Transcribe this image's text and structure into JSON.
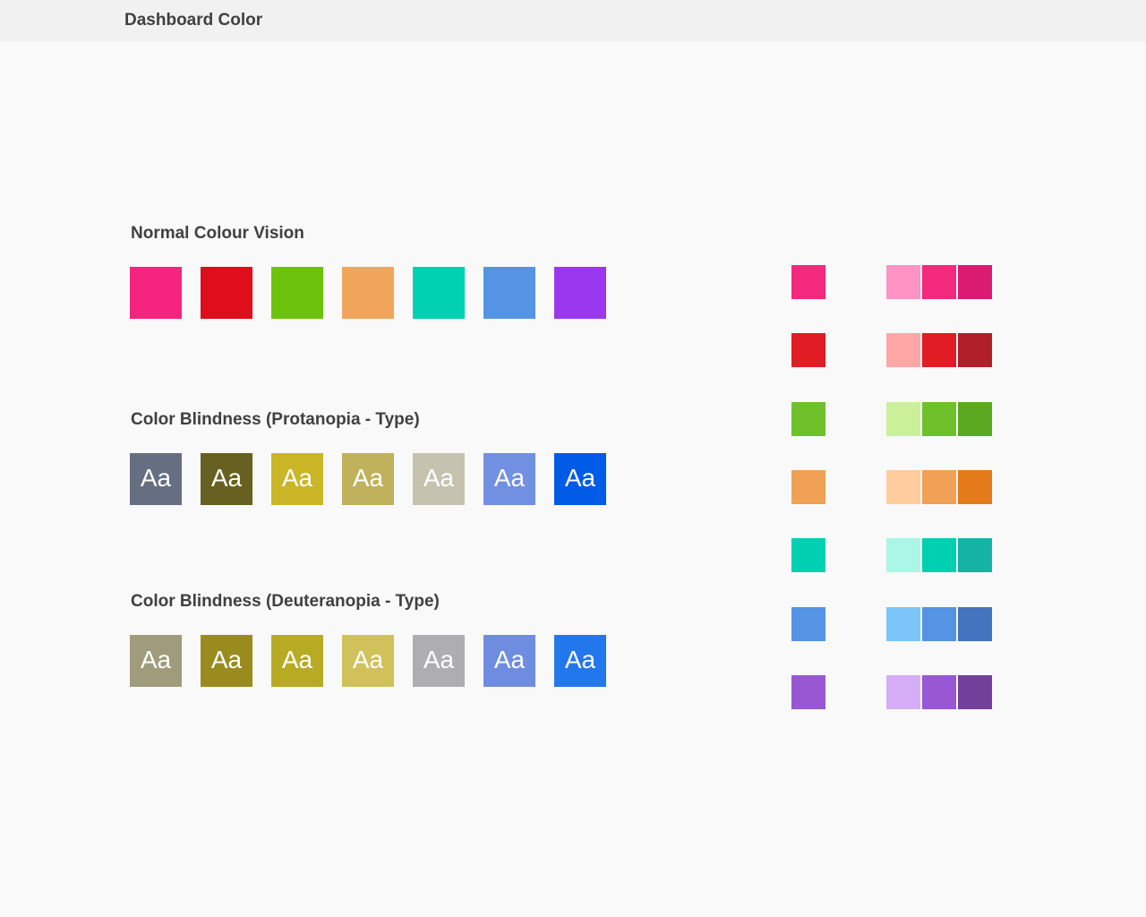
{
  "header": {
    "title": "Dashboard Color"
  },
  "sections": [
    {
      "title": "Normal Colour Vision",
      "swatches": [
        {
          "color": "#f5247e",
          "label": ""
        },
        {
          "color": "#e00e1b",
          "label": ""
        },
        {
          "color": "#6bc40b",
          "label": ""
        },
        {
          "color": "#f0a55a",
          "label": ""
        },
        {
          "color": "#00d1b2",
          "label": ""
        },
        {
          "color": "#5593e4",
          "label": ""
        },
        {
          "color": "#9b37ee",
          "label": ""
        }
      ]
    },
    {
      "title": "Color Blindness (Protanopia - Type)",
      "swatches": [
        {
          "color": "#666e82",
          "label": "Aa"
        },
        {
          "color": "#676020",
          "label": "Aa"
        },
        {
          "color": "#cab626",
          "label": "Aa"
        },
        {
          "color": "#c0b15c",
          "label": "Aa"
        },
        {
          "color": "#c5c3b0",
          "label": "Aa"
        },
        {
          "color": "#7290e1",
          "label": "Aa"
        },
        {
          "color": "#005be6",
          "label": "Aa"
        }
      ]
    },
    {
      "title": "Color Blindness (Deuteranopia - Type)",
      "swatches": [
        {
          "color": "#9f9c7c",
          "label": "Aa"
        },
        {
          "color": "#9a8b1f",
          "label": "Aa"
        },
        {
          "color": "#b9aa24",
          "label": "Aa"
        },
        {
          "color": "#d1c15b",
          "label": "Aa"
        },
        {
          "color": "#aeaeb0",
          "label": "Aa"
        },
        {
          "color": "#6e8de0",
          "label": "Aa"
        },
        {
          "color": "#2377ec",
          "label": "Aa"
        }
      ]
    }
  ],
  "palette": [
    {
      "base": "#f2297d",
      "light": "#fe94c3",
      "main": "#f2297d",
      "dark": "#db1a72"
    },
    {
      "base": "#e01c24",
      "light": "#ffa7a7",
      "main": "#e01c24",
      "dark": "#b01f28"
    },
    {
      "base": "#6fc12b",
      "light": "#caf19a",
      "main": "#6fc12b",
      "dark": "#5aa921"
    },
    {
      "base": "#f0a155",
      "light": "#ffcd9d",
      "main": "#f0a155",
      "dark": "#e47a19"
    },
    {
      "base": "#00d0b2",
      "light": "#abf6e6",
      "main": "#00d0b2",
      "dark": "#14b3a5"
    },
    {
      "base": "#5593e4",
      "light": "#7cc4fa",
      "main": "#5593e4",
      "dark": "#4474c0"
    },
    {
      "base": "#9858d4",
      "light": "#d6adf7",
      "main": "#9858d4",
      "dark": "#723f9b"
    }
  ]
}
